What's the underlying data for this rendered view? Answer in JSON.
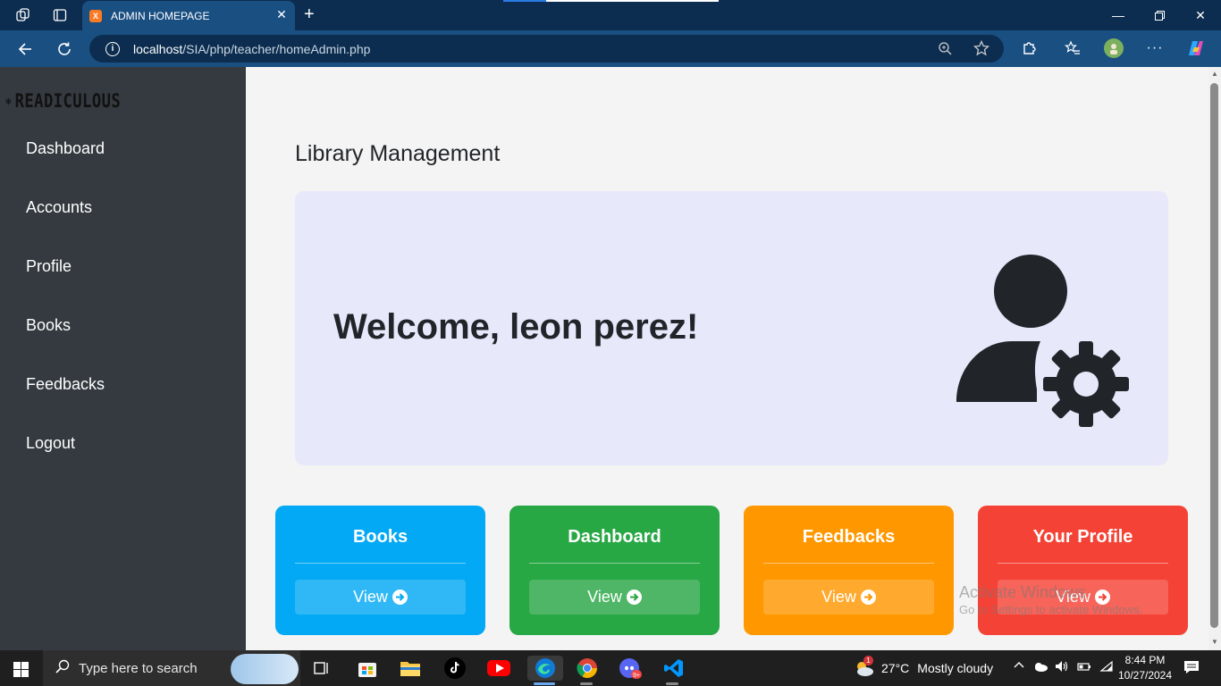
{
  "browser": {
    "tab_title": "ADMIN HOMEPAGE",
    "tab_favicon_letter": "X",
    "url_host": "localhost",
    "url_path": "/SIA/php/teacher/homeAdmin.php"
  },
  "sidebar": {
    "brand": "READICULOUS",
    "items": [
      {
        "label": "Dashboard"
      },
      {
        "label": "Accounts"
      },
      {
        "label": "Profile"
      },
      {
        "label": "Books"
      },
      {
        "label": "Feedbacks"
      },
      {
        "label": "Logout"
      }
    ]
  },
  "main": {
    "title": "Library Management",
    "welcome": "Welcome, leon perez!",
    "cards": [
      {
        "title": "Books",
        "button": "View",
        "color": "#03a9f4"
      },
      {
        "title": "Dashboard",
        "button": "View",
        "color": "#28a745"
      },
      {
        "title": "Feedbacks",
        "button": "View",
        "color": "#ff9800"
      },
      {
        "title": "Your Profile",
        "button": "View",
        "color": "#f44336"
      }
    ]
  },
  "watermark": {
    "line1": "Activate Windows",
    "line2": "Go to Settings to activate Windows."
  },
  "taskbar": {
    "search_placeholder": "Type here to search",
    "weather_temp": "27°C",
    "weather_desc": "Mostly cloudy",
    "weather_badge": "1",
    "time": "8:44 PM",
    "date": "10/27/2024"
  }
}
